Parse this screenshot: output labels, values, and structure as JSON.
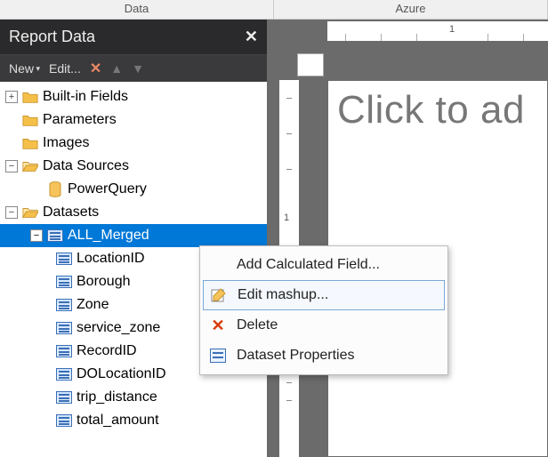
{
  "topbar": {
    "left": "Data",
    "right": "Azure"
  },
  "panel": {
    "title": "Report Data",
    "toolbar": {
      "new": "New",
      "edit": "Edit..."
    }
  },
  "tree": {
    "builtin": "Built-in Fields",
    "parameters": "Parameters",
    "images": "Images",
    "datasources": "Data Sources",
    "powerquery": "PowerQuery",
    "datasets": "Datasets",
    "all_merged": "ALL_Merged",
    "fields": [
      "LocationID",
      "Borough",
      "Zone",
      "service_zone",
      "RecordID",
      "DOLocationID",
      "trip_distance",
      "total_amount"
    ]
  },
  "canvas": {
    "placeholder": "Click to ad"
  },
  "ruler": {
    "n1": "1"
  },
  "context_menu": {
    "add_calc": "Add Calculated Field...",
    "edit_mashup": "Edit mashup...",
    "delete": "Delete",
    "props": "Dataset Properties"
  }
}
